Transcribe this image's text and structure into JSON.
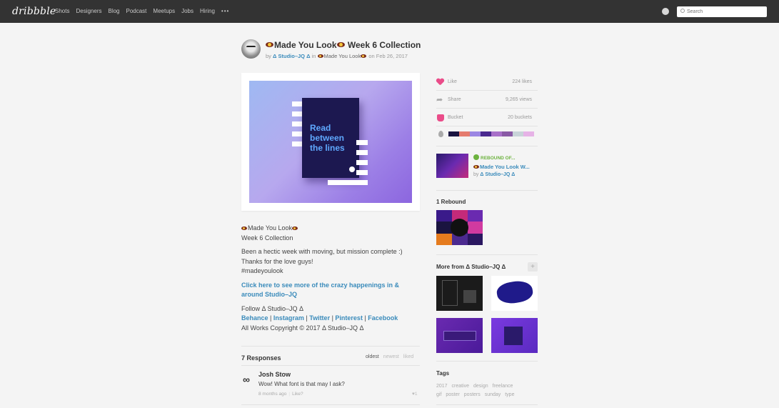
{
  "nav": {
    "logo": "dribbble",
    "links": [
      "Shots",
      "Designers",
      "Blog",
      "Podcast",
      "Meetups",
      "Jobs",
      "Hiring"
    ],
    "more": "•••",
    "search_placeholder": "Search"
  },
  "shot": {
    "title": "Made You Look",
    "title_suffix": " Week 6 Collection",
    "by_prefix": "by",
    "author": "Δ Studio–JQ Δ",
    "in_text": "in",
    "team": "Made You Look",
    "on_text": "on",
    "date": "Feb 26, 2017",
    "cover_text": "Read between the lines"
  },
  "description": {
    "line1": "Made You Look",
    "line2": "Week 6 Collection",
    "para2_l1": "Been a hectic week with moving, but mission complete :)",
    "para2_l2": "Thanks for the love guys!",
    "para2_l3": "#madeyoulook",
    "link_text": "Click here to see more of the crazy happenings in & around Studio–JQ",
    "follow": "Follow Δ Studio–JQ Δ",
    "social": [
      "Behance",
      "Instagram",
      "Twitter",
      "Pinterest",
      "Facebook"
    ],
    "social_sep": " | ",
    "copyright": "All Works Copyright © 2017 Δ Studio–JQ Δ"
  },
  "responses": {
    "title": "7 Responses",
    "sort": [
      "oldest",
      "newest",
      "liked"
    ],
    "comment": {
      "name": "Josh Stow",
      "text": "Wow! What font is that may I ask?",
      "time": "8 months ago",
      "like_label": "Like?",
      "likes": "♥1"
    }
  },
  "stats": {
    "like_label": "Like",
    "like_value": "224 likes",
    "share_label": "Share",
    "share_value": "9,265 views",
    "bucket_label": "Bucket",
    "bucket_value": "20 buckets",
    "palette": [
      "#1a1440",
      "#e57b6e",
      "#9b86e3",
      "#4b2a8f",
      "#a870c8",
      "#8a5aa5",
      "#c8d4d8",
      "#e6b2e6"
    ]
  },
  "rebound_of": {
    "label": "REBOUND OF...",
    "title": "Made You Look W...",
    "by_prefix": "by",
    "author": "Δ Studio–JQ Δ"
  },
  "rebounds": {
    "title": "1 Rebound"
  },
  "more_from": {
    "title": "More from Δ Studio–JQ Δ",
    "plus": "+"
  },
  "tags": {
    "title": "Tags",
    "items": [
      "2017",
      "creative",
      "design",
      "freelance",
      "gif",
      "poster",
      "posters",
      "sunday",
      "type"
    ]
  },
  "colors": {
    "accent_blue": "#3a8bbb",
    "pink": "#ea4c89",
    "nav_bg": "#333333"
  }
}
